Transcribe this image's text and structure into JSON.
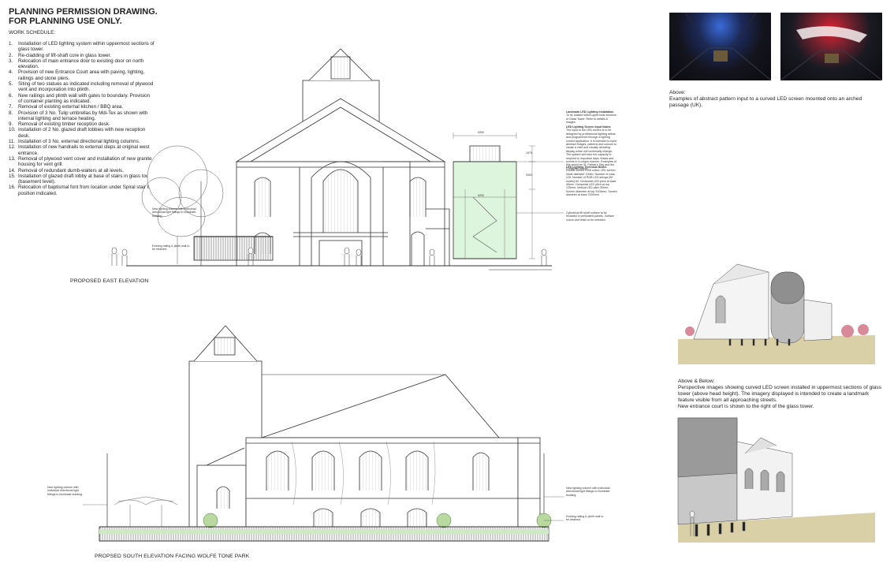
{
  "header": {
    "line1": "PLANNING PERMISSION DRAWING.",
    "line2": "FOR PLANNING USE  ONLY."
  },
  "work_schedule": {
    "heading": "WORK SCHEDULE:",
    "items": [
      {
        "n": "1.",
        "text": "Installation of LED lighting system within uppermost sections of glass tower."
      },
      {
        "n": "2.",
        "text": "Re-cladding of lift-shaft core in glass tower."
      },
      {
        "n": "3.",
        "text": "Relocation of main entrance door to existing door on north elevation."
      },
      {
        "n": "4.",
        "text": "Provision of new Entrance Court area with paving, lighting, railings and stone piers."
      },
      {
        "n": "5.",
        "text": "Siting of two statues as indicated including removal of plywood vent and incorporation into plinth."
      },
      {
        "n": "6.",
        "text": "New railings and plinth wall with gates to boundary. Provision of container planting as indicated."
      },
      {
        "n": "7.",
        "text": "Removal of existing external kitchen / BBQ area."
      },
      {
        "n": "8.",
        "text": "Provision of 3 No. Tulip umbrellas by Mdi-Tex as shown with internal lighting and terrace heating."
      },
      {
        "n": "9.",
        "text": "Removal of existing timber reception desk."
      },
      {
        "n": "10.",
        "text": "Installation of 2 No. glazed draft lobbies with new reception desk."
      },
      {
        "n": "11.",
        "text": "Installation of 3 No. external directional lighting columns."
      },
      {
        "n": "12.",
        "text": "Installation of new handrails to external steps at original west entrance."
      },
      {
        "n": "13.",
        "text": "Removal of plywood vent cover and installation of new granite housing for vent grill."
      },
      {
        "n": "14.",
        "text": "Removal of redundant dumb-waiters at all levels."
      },
      {
        "n": "15.",
        "text": "Installation of glazed draft lobby at base of stairs in glass tower (basement level)."
      },
      {
        "n": "16.",
        "text": "Relocation of baptismal font from location under Spiral stair to position indicated."
      }
    ]
  },
  "drawings": {
    "east_caption": "PROPOSED EAST  ELEVATION",
    "south_caption": "PROPSED SOUTH ELEVATION      FACING WOLFE TONE PARK"
  },
  "annotations": {
    "east_column": "New lighting column with individual directional light fittings to illuminate building.",
    "east_railing": "Existing railing & plinth wall to be retained.",
    "led_title": "Landmark LED Lighting Installation",
    "led_body": "To be located within uppermost sections of Glass Tower. Refer to details & images.",
    "screen_title": "LED Lighting Screen Input Notes:",
    "screen_body": "The input to the LED screen is to be designed by professional lighting artists and programmed through a lighting control application. It is intended to input abstract images, patterns and colours to create a vivid and visually arresting display which will continually change. The system will have the capacity to respond to important days, feasts and events in a unique manner. Examples of this would be St. Patrick's Day and the Christmas period.",
    "tech_title": "LED Lighting Technical Notes:",
    "tech_body": "Double curved RGB colour LED screen. Node diameter 10mm. Number of rows 125. Number of RGB LED strings (50 nodes) 64. Horizontal LED pitch at base 45mm. Horizontal LED pitch at top 125mm. Vertical LED pitch 50mm. Screen diameter at top 3100mm. Screen diameter at base 2200mm.",
    "mesh_note": "Cylindrical lift shaft surface to be recladed in perforated panels. Surface colour and finish to be selected.",
    "dim_1": "5300",
    "dim_2": "1975",
    "dim_3": "3300",
    "dim_4": "5200",
    "south_left_col": "New lighting column with individual directional light fittings to illuminate building.",
    "south_right_col": "New lighting column with individual directional light fittings to illuminate building.",
    "south_railing": "Existing railing & plinth wall to be retained."
  },
  "side_panel": {
    "above_label": "Above:",
    "above_text": "Examples of abstract pattern input to a curved LED screen mounted onto an arched passage (UK).",
    "below_label": "Above & Below:",
    "below_text": "Perspective images showing curved LED screen installed in uppermost sections of glass tower (above head height). The imagery displayed is intended to create a landmark feature visible from all approaching streets.",
    "below_text2": "New entrance court is shown to the right of the glass tower."
  },
  "colors": {
    "ink": "#333333",
    "glass": "#c9f0c9",
    "photo_dark": "#1a1a22",
    "led_blue": "#3a6bd8",
    "led_red": "#e02030",
    "ground": "#d9d0a8"
  }
}
